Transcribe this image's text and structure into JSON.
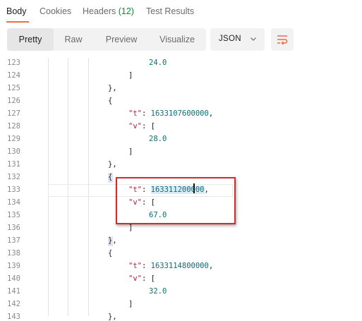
{
  "tabs": [
    {
      "label": "Body"
    },
    {
      "label": "Cookies"
    },
    {
      "label": "Headers",
      "count": "(12)"
    },
    {
      "label": "Test Results"
    }
  ],
  "view_modes": [
    "Pretty",
    "Raw",
    "Preview",
    "Visualize"
  ],
  "active_view": "Pretty",
  "format": "JSON",
  "colors": {
    "accent": "#f26b3a",
    "key": "#a0243a",
    "number": "#0b6e76",
    "annotation": "#d32a2a"
  },
  "lines": [
    {
      "n": "123",
      "text": "24.0"
    },
    {
      "n": "124",
      "text": "]"
    },
    {
      "n": "125",
      "text": "},"
    },
    {
      "n": "126",
      "text": "{"
    },
    {
      "n": "127",
      "key": "\"t\"",
      "value": "1633107600000",
      "tail": ","
    },
    {
      "n": "128",
      "key": "\"v\"",
      "tail": "["
    },
    {
      "n": "129",
      "text": "28.0"
    },
    {
      "n": "130",
      "text": "]"
    },
    {
      "n": "131",
      "text": "},"
    },
    {
      "n": "132",
      "text": "{"
    },
    {
      "n": "133",
      "key": "\"t\"",
      "value_a": "163311",
      "value_b": "2",
      "value_c": "00000",
      "tail": ","
    },
    {
      "n": "134",
      "key": "\"v\"",
      "tail": "["
    },
    {
      "n": "135",
      "text": "67.0"
    },
    {
      "n": "136",
      "text": "]"
    },
    {
      "n": "137",
      "text": "},"
    },
    {
      "n": "138",
      "text": "{"
    },
    {
      "n": "139",
      "key": "\"t\"",
      "value": "1633114800000",
      "tail": ","
    },
    {
      "n": "140",
      "key": "\"v\"",
      "tail": "["
    },
    {
      "n": "141",
      "text": "32.0"
    },
    {
      "n": "142",
      "text": "]"
    },
    {
      "n": "143",
      "text": "},"
    }
  ]
}
